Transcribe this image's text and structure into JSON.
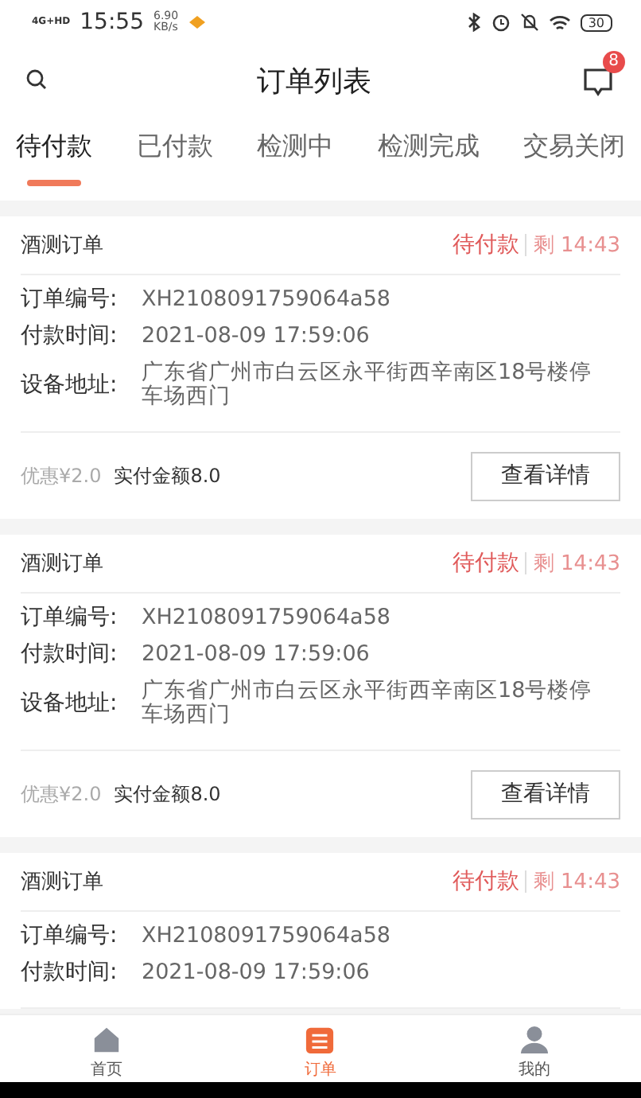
{
  "status_bar": {
    "network": "4G+HD",
    "time": "15:55",
    "speed": "6.90",
    "speed_unit": "KB/s",
    "battery": "30"
  },
  "header": {
    "title": "订单列表",
    "badge": "8"
  },
  "tabs": [
    {
      "label": "待付款",
      "selected": true
    },
    {
      "label": "已付款",
      "selected": false
    },
    {
      "label": "检测中",
      "selected": false
    },
    {
      "label": "检测完成",
      "selected": false
    },
    {
      "label": "交易关闭",
      "selected": false
    }
  ],
  "orders": [
    {
      "title": "酒测订单",
      "status": "待付款",
      "remaining": "剩 14:43",
      "rows": [
        {
          "label": "订单编号:",
          "value": "XH2108091759064a58"
        },
        {
          "label": "付款时间:",
          "value": "2021-08-09 17:59:06"
        },
        {
          "label": "设备地址:",
          "value": "广东省广州市白云区永平街西辛南区18号楼停车场西门"
        }
      ],
      "discount": "优惠¥2.0",
      "paid": "实付金额8.0",
      "button": "查看详情"
    },
    {
      "title": "酒测订单",
      "status": "待付款",
      "remaining": "剩 14:43",
      "rows": [
        {
          "label": "订单编号:",
          "value": "XH2108091759064a58"
        },
        {
          "label": "付款时间:",
          "value": "2021-08-09 17:59:06"
        },
        {
          "label": "设备地址:",
          "value": "广东省广州市白云区永平街西辛南区18号楼停车场西门"
        }
      ],
      "discount": "优惠¥2.0",
      "paid": "实付金额8.0",
      "button": "查看详情"
    },
    {
      "title": "酒测订单",
      "status": "待付款",
      "remaining": "剩 14:43",
      "rows": [
        {
          "label": "订单编号:",
          "value": "XH2108091759064a58"
        },
        {
          "label": "付款时间:",
          "value": "2021-08-09 17:59:06"
        }
      ]
    }
  ],
  "bottom_nav": [
    {
      "kind": "home",
      "label": "首页",
      "selected": false
    },
    {
      "kind": "orders",
      "label": "订单",
      "selected": true
    },
    {
      "kind": "profile",
      "label": "我的",
      "selected": false
    }
  ]
}
